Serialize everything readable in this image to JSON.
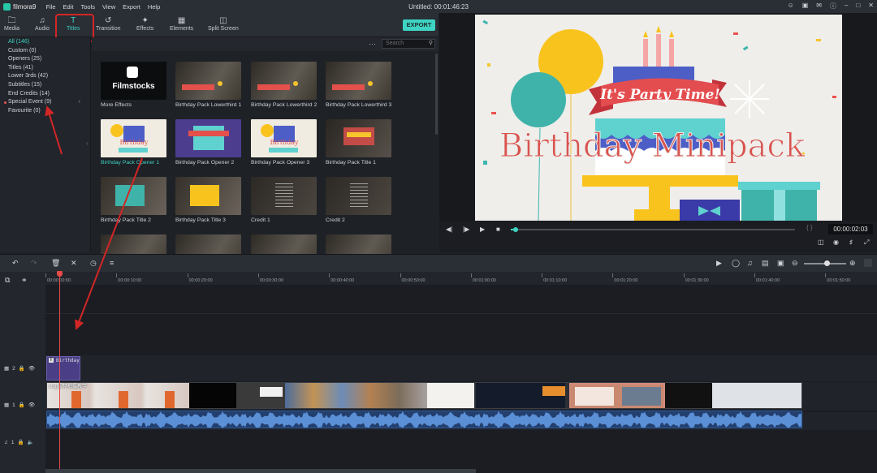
{
  "app": {
    "name": "filmora9",
    "window_title": "Untitled: 00:01:46:23"
  },
  "menu": [
    "File",
    "Edit",
    "Tools",
    "View",
    "Export",
    "Help"
  ],
  "tabs": [
    {
      "label": "Media",
      "icon": "folder-icon"
    },
    {
      "label": "Audio",
      "icon": "music-note-icon"
    },
    {
      "label": "Titles",
      "icon": "text-t-icon",
      "active": true
    },
    {
      "label": "Transition",
      "icon": "transition-icon"
    },
    {
      "label": "Effects",
      "icon": "effects-icon"
    },
    {
      "label": "Elements",
      "icon": "image-icon"
    },
    {
      "label": "Split Screen",
      "icon": "split-screen-icon"
    }
  ],
  "export_label": "EXPORT",
  "search": {
    "placeholder": "Search"
  },
  "categories": [
    {
      "label": "All (146)",
      "selected": true
    },
    {
      "label": "Custom (0)"
    },
    {
      "label": "Openers (25)"
    },
    {
      "label": "Titles (41)"
    },
    {
      "label": "Lower 3rds (42)"
    },
    {
      "label": "Subtitles (15)"
    },
    {
      "label": "End Credits (14)"
    },
    {
      "label": "Special Event (9)",
      "dot": true,
      "expandable": true
    },
    {
      "label": "Favourite (0)"
    }
  ],
  "thumbnails": [
    {
      "label": "More Effects",
      "style": "filmstocks",
      "text": "Filmstocks"
    },
    {
      "label": "Birthday Pack Lowerthird 1",
      "style": "lowerthird"
    },
    {
      "label": "Birthday Pack Lowerthird 2",
      "style": "lowerthird"
    },
    {
      "label": "Birthday Pack Lowerthird 3",
      "style": "lowerthird"
    },
    {
      "label": "Birthday Pack Opener 1",
      "style": "opener-light",
      "selected": true
    },
    {
      "label": "Birthday Pack Opener 2",
      "style": "opener-purple"
    },
    {
      "label": "Birthday Pack Opener 3",
      "style": "opener-light"
    },
    {
      "label": "Birthday Pack Title 1",
      "style": "title-dark"
    },
    {
      "label": "Birthday Pack Title 2",
      "style": "title-photo"
    },
    {
      "label": "Birthday Pack Title 3",
      "style": "title-photo"
    },
    {
      "label": "Credit 1",
      "style": "credit"
    },
    {
      "label": "Credit 2",
      "style": "credit"
    },
    {
      "label": "",
      "style": "lowerthird"
    },
    {
      "label": "",
      "style": "lowerthird"
    },
    {
      "label": "",
      "style": "lowerthird"
    },
    {
      "label": "",
      "style": "lowerthird"
    }
  ],
  "preview": {
    "banner_text": "It's Party Time!",
    "title_text": "Birthday Minipack",
    "timecode": "00:00:02:03",
    "progress": 0.01
  },
  "timeline": {
    "ruler": [
      "00:00:00:00",
      "00:00:10:00",
      "00:00:20:00",
      "00:00:30:00",
      "00:00:40:00",
      "00:00:50:00",
      "00:01:00:00",
      "00:01:10:00",
      "00:01:20:00",
      "00:01:30:00",
      "00:01:40:00",
      "00:01:50:00"
    ],
    "tracks": [
      {
        "label": "2"
      },
      {
        "label": "1"
      },
      {
        "label": "1"
      }
    ],
    "title_clip": "Birthday",
    "video_clip_label": "vlog视频拍摄教学"
  },
  "colors": {
    "accent": "#3fd3c3",
    "highlight": "#d32626",
    "playhead": "#e84a4a"
  }
}
